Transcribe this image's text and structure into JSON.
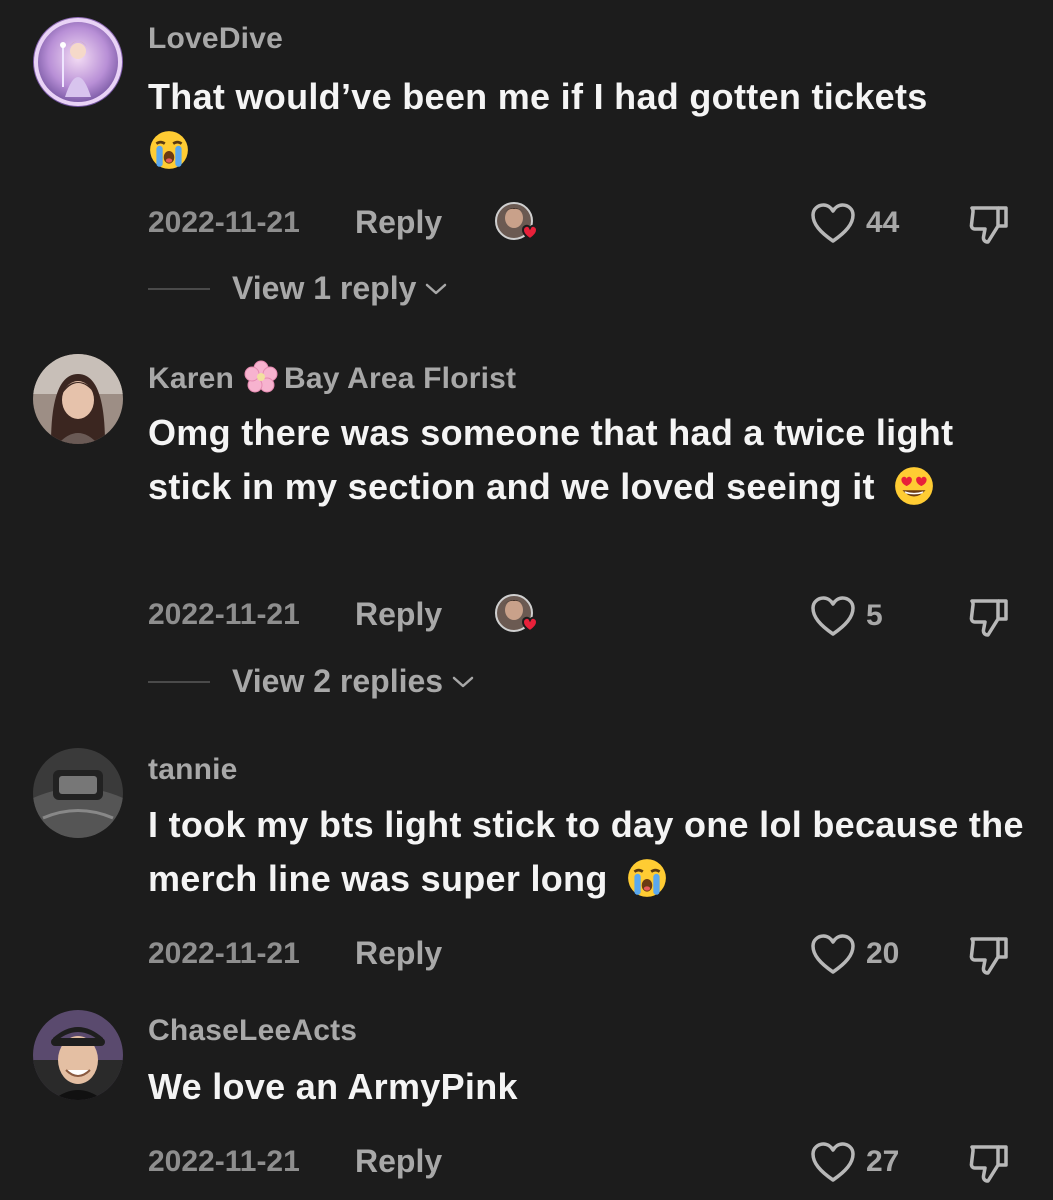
{
  "colors": {
    "background": "#1c1c1c",
    "username": "#a8a8a8",
    "text": "#f4f4f4",
    "muted": "#8e8e8e",
    "heart_red": "#e8213a"
  },
  "comments": [
    {
      "username": "LoveDive",
      "text": "That would’ve been me if I had gotten tickets",
      "emoji": "loudly-crying-face-icon",
      "date": "2022-11-21",
      "reply_label": "Reply",
      "creator_liked": true,
      "likes": "44",
      "view_replies": "View 1 reply"
    },
    {
      "username": "Karen",
      "username_suffix": "Bay Area Florist",
      "username_emoji": "cherry-blossom-icon",
      "text": "Omg there was someone that had a twice light stick in my section and we loved seeing it",
      "emoji": "heart-eyes-face-icon",
      "date": "2022-11-21",
      "reply_label": "Reply",
      "creator_liked": true,
      "likes": "5",
      "view_replies": "View 2 replies"
    },
    {
      "username": "tannie",
      "text": "I took my bts light stick to day one lol because the merch line was super long",
      "emoji": "loudly-crying-face-icon",
      "date": "2022-11-21",
      "reply_label": "Reply",
      "likes": "20"
    },
    {
      "username": "ChaseLeeActs",
      "text": "We love an ArmyPink",
      "date": "2022-11-21",
      "reply_label": "Reply",
      "likes": "27"
    }
  ]
}
